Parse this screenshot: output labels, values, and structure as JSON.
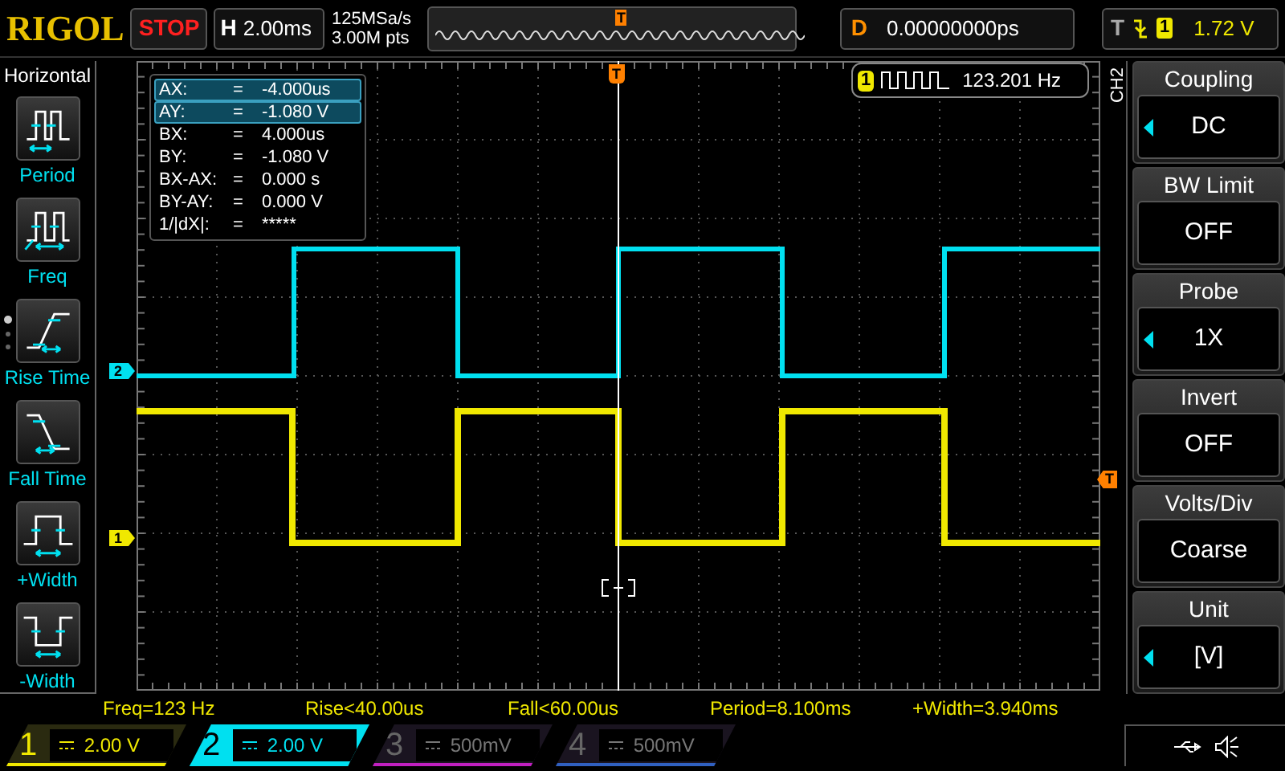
{
  "top_bar": {
    "logo": "RIGOL",
    "run_state": "STOP",
    "timebase": {
      "label": "H",
      "value": "2.00ms"
    },
    "sample_rate": "125MSa/s",
    "memory_depth": "3.00M pts",
    "overview_marker": "T",
    "delay": {
      "label": "D",
      "value": "0.00000000ps"
    },
    "trigger": {
      "label": "T",
      "source": "1",
      "level": "1.72 V"
    }
  },
  "left_menu": {
    "title": "Horizontal",
    "items": [
      {
        "kind": "period",
        "label": "Period"
      },
      {
        "kind": "freq",
        "label": "Freq"
      },
      {
        "kind": "rise",
        "label": "Rise Time"
      },
      {
        "kind": "fall",
        "label": "Fall Time"
      },
      {
        "kind": "pwidth",
        "label": "+Width"
      },
      {
        "kind": "nwidth",
        "label": "-Width"
      }
    ]
  },
  "cursor_readout": [
    {
      "label": "AX:",
      "eq": "=",
      "value": "-4.000us",
      "selected": true
    },
    {
      "label": "AY:",
      "eq": "=",
      "value": "-1.080 V",
      "selected": true
    },
    {
      "label": "BX:",
      "eq": "=",
      "value": "4.000us",
      "selected": false
    },
    {
      "label": "BY:",
      "eq": "=",
      "value": "-1.080 V",
      "selected": false
    },
    {
      "label": "BX-AX:",
      "eq": "=",
      "value": "0.000 s",
      "selected": false
    },
    {
      "label": "BY-AY:",
      "eq": "=",
      "value": "0.000 V",
      "selected": false
    },
    {
      "label": "1/|dX|:",
      "eq": "=",
      "value": "*****",
      "selected": false
    }
  ],
  "frequency_counter": {
    "channel": "1",
    "value": "123.201 Hz"
  },
  "markers": {
    "trigger_position": "T",
    "trigger_level": "T",
    "channels": [
      {
        "label": "2",
        "color": "#00e0f0"
      },
      {
        "label": "1",
        "color": "#f0e800"
      }
    ]
  },
  "measurements": [
    "Freq=123 Hz",
    "Rise<40.00us",
    "Fall<60.00us",
    "Period=8.100ms",
    "+Width=3.940ms"
  ],
  "channels": [
    {
      "number": "1",
      "value": "2.00 V",
      "enabled": true,
      "selected": false,
      "color": "#f0e800"
    },
    {
      "number": "2",
      "value": "2.00 V",
      "enabled": true,
      "selected": true,
      "color": "#00e0f0"
    },
    {
      "number": "3",
      "value": "500mV",
      "enabled": false,
      "selected": false,
      "color": "#c020c0"
    },
    {
      "number": "4",
      "value": "500mV",
      "enabled": false,
      "selected": false,
      "color": "#3060c0"
    }
  ],
  "right_menu": {
    "channel_label": "CH2",
    "items": [
      {
        "title": "Coupling",
        "value": "DC",
        "adjustable": true
      },
      {
        "title": "BW Limit",
        "value": "OFF",
        "adjustable": false
      },
      {
        "title": "Probe",
        "value": "1X",
        "adjustable": true
      },
      {
        "title": "Invert",
        "value": "OFF",
        "adjustable": false
      },
      {
        "title": "Volts/Div",
        "value": "Coarse",
        "adjustable": false
      },
      {
        "title": "Unit",
        "value": "[V]",
        "adjustable": true
      }
    ]
  }
}
